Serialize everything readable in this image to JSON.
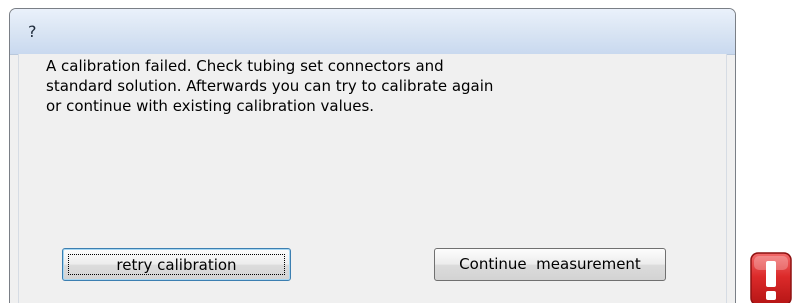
{
  "window": {
    "title": "?"
  },
  "dialog": {
    "message": "A calibration failed. Check tubing set connectors and\nstandard solution. Afterwards you can try to calibrate again\nor continue with existing calibration values.",
    "buttons": {
      "retry_label": "retry calibration",
      "continue_label": "Continue  measurement"
    }
  },
  "icons": {
    "status": "error-icon"
  },
  "colors": {
    "titlebar": "#d6e3f3",
    "dialog_background": "#f0f0f0",
    "error_icon": "#d8252b"
  }
}
